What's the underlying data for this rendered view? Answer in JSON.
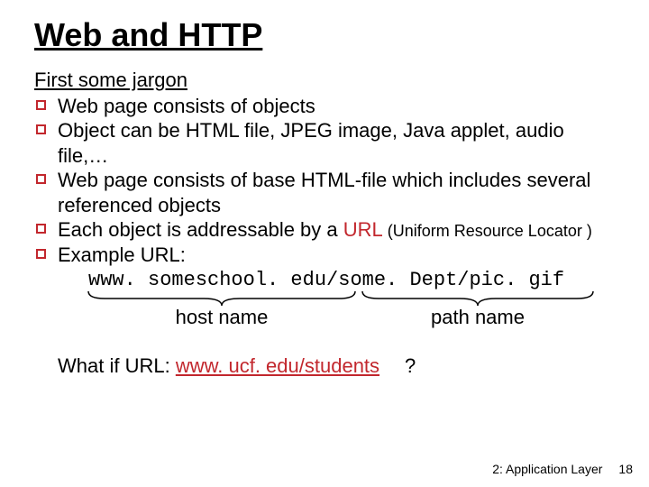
{
  "title": "Web and HTTP",
  "subhead": "First some jargon",
  "bullets": {
    "b1": "Web page consists of objects",
    "b2": "Object can be HTML file, JPEG image, Java applet, audio file,…",
    "b3": "Web page consists of base HTML-file which includes several referenced objects",
    "b4_pre": "Each object is addressable by a ",
    "b4_url": "URL",
    "b4_note": " (Uniform Resource Locator )",
    "b5": "Example URL:"
  },
  "example_url": "www. someschool. edu/some. Dept/pic. gif",
  "brace_host": "host name",
  "brace_path": "path name",
  "whatif_pre": "What if URL: ",
  "whatif_link": "www. ucf. edu/students",
  "whatif_q": "?",
  "footer_chapter": "2: Application Layer",
  "footer_page": "18"
}
